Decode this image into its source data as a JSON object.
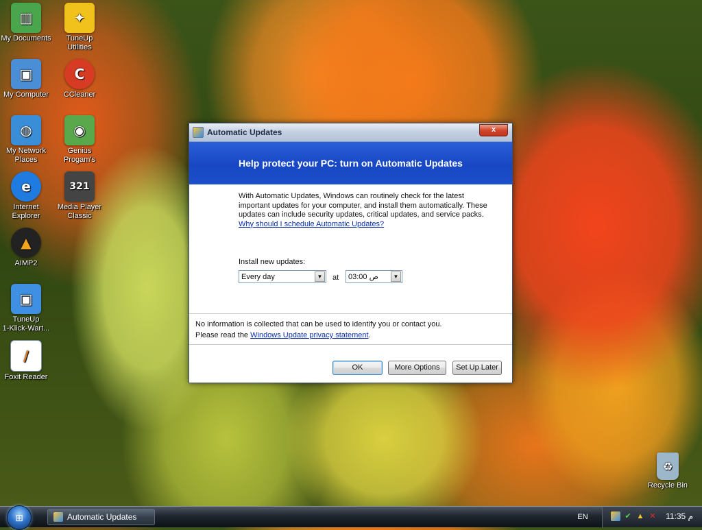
{
  "desktop": {
    "icons": [
      {
        "label_line1": "My Documents",
        "label_line2": "",
        "icon": "documents-folder-icon",
        "color": "#4aa64c"
      },
      {
        "label_line1": "TuneUp Utilities",
        "label_line2": "",
        "icon": "tuneup-utilities-icon",
        "color": "#f1c21b"
      },
      {
        "label_line1": "My Computer",
        "label_line2": "",
        "icon": "computer-icon",
        "color": "#4a8fd6"
      },
      {
        "label_line1": "CCleaner",
        "label_line2": "",
        "icon": "ccleaner-icon",
        "color": "#d83b23"
      },
      {
        "label_line1": "My Network",
        "label_line2": "Places",
        "icon": "network-places-icon",
        "color": "#3a8ed8"
      },
      {
        "label_line1": "Genius",
        "label_line2": "Progam's",
        "icon": "genius-programs-icon",
        "color": "#5aa84c"
      },
      {
        "label_line1": "Internet",
        "label_line2": "Explorer",
        "icon": "internet-explorer-icon",
        "color": "#1f7be0"
      },
      {
        "label_line1": "Media Player",
        "label_line2": "Classic",
        "icon": "media-player-classic-icon",
        "color": "#444444"
      },
      {
        "label_line1": "AIMP2",
        "label_line2": "",
        "icon": "aimp2-icon",
        "color": "#222222"
      },
      {
        "label_line1": "TuneUp",
        "label_line2": "1-Klick-Wart...",
        "icon": "tuneup-1-click-icon",
        "color": "#3f8fe2"
      },
      {
        "label_line1": "Foxit Reader",
        "label_line2": "",
        "icon": "foxit-reader-icon",
        "color": "#e07a1f"
      },
      {
        "label_line1": "Recycle Bin",
        "label_line2": "",
        "icon": "recycle-bin-icon",
        "color": "#9bb7c9"
      }
    ]
  },
  "dialog": {
    "title": "Automatic Updates",
    "close_glyph": "x",
    "banner": "Help protect your PC: turn on Automatic Updates",
    "description": "With Automatic Updates, Windows can routinely check for the latest important updates for your computer, and install them automatically. These updates can include security updates, critical updates, and service packs.",
    "why_link": "Why should I schedule Automatic Updates?",
    "install_label": "Install new updates:",
    "frequency_value": "Every day",
    "at_label": "at",
    "time_value": "03:00 ص",
    "privacy_line1": "No information is collected that can be used to identify you or contact you.",
    "privacy_prefix": "Please read the ",
    "privacy_link": "Windows Update privacy statement",
    "privacy_suffix": ".",
    "buttons": {
      "ok": "OK",
      "more_options": "More Options",
      "set_up_later": "Set Up Later"
    }
  },
  "taskbar": {
    "start_glyph": "⊞",
    "task_item": "Automatic Updates",
    "language": "EN",
    "clock": "11:35 م"
  },
  "colors": {
    "banner_blue": "#1847c4",
    "link_blue": "#0b2fa8",
    "close_red": "#d1472d"
  }
}
